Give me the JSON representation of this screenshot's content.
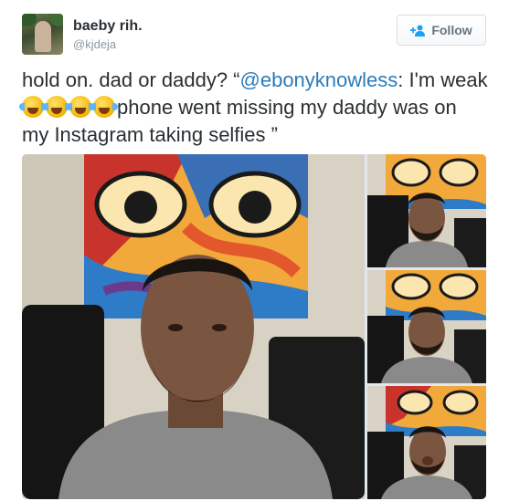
{
  "user": {
    "name": "baeby rih.",
    "handle": "@kjdeja",
    "avatar_icon": "profile-photo"
  },
  "follow_button": {
    "label": "Follow",
    "icon": "add-user-icon",
    "color": "#66757f"
  },
  "tweet": {
    "text_before_mention": "hold on. dad or daddy? “",
    "mention": "@ebonyknowless",
    "text_after_mention": ": I'm weak ",
    "emoji_name": "face-with-tears-of-joy",
    "emoji_count": 4,
    "text_after_emoji": "phone went missing my daddy was on my Instagram taking selfies ”",
    "mention_color": "#2b7bb9"
  },
  "media": {
    "photo_count": 4,
    "photos": [
      {
        "name": "selfie-main",
        "subject": "man selfie in front of colorful abstract painting"
      },
      {
        "name": "selfie-thumb-1",
        "subject": "man selfie"
      },
      {
        "name": "selfie-thumb-2",
        "subject": "man selfie"
      },
      {
        "name": "selfie-thumb-3",
        "subject": "man selfie pouting lips"
      }
    ]
  }
}
